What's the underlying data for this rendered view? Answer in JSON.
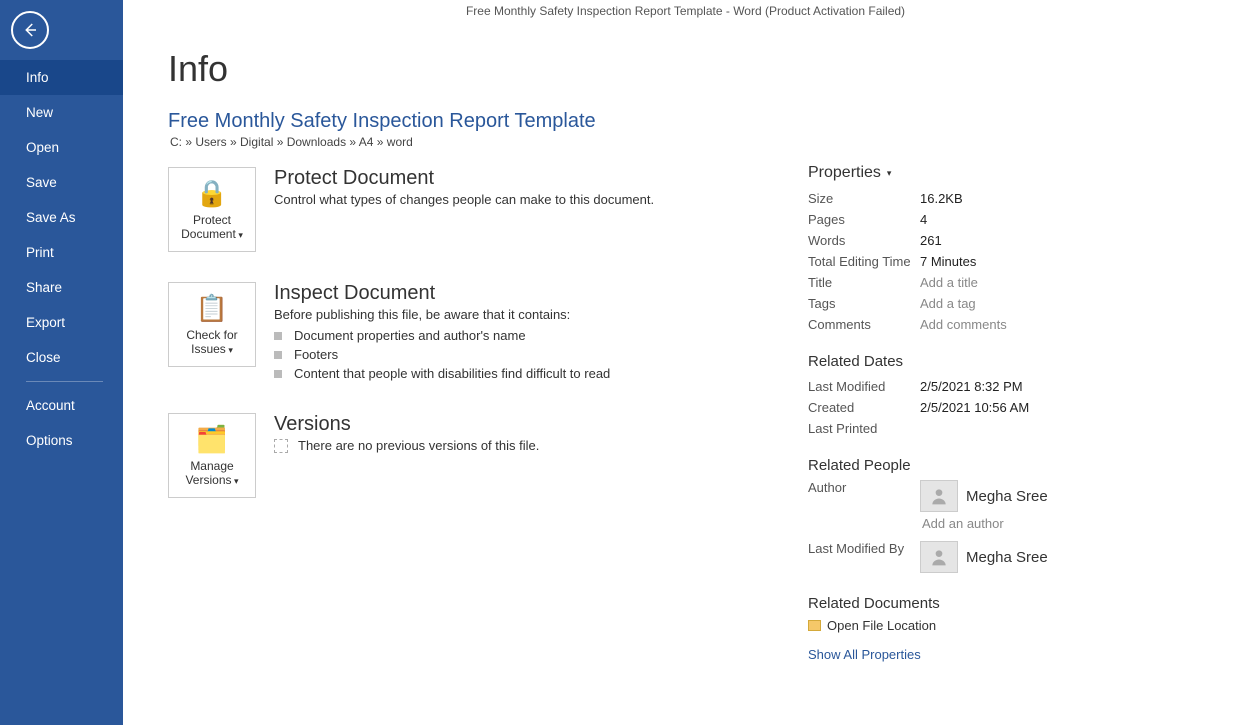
{
  "titlebar": "Free Monthly Safety Inspection Report Template - Word (Product Activation Failed)",
  "sidebar": {
    "items": [
      "Info",
      "New",
      "Open",
      "Save",
      "Save As",
      "Print",
      "Share",
      "Export",
      "Close"
    ],
    "bottom": [
      "Account",
      "Options"
    ],
    "active": "Info"
  },
  "page": {
    "title": "Info",
    "docTitle": "Free Monthly Safety Inspection Report Template",
    "docPath": "C: » Users » Digital » Downloads » A4 » word"
  },
  "protect": {
    "tileLine1": "Protect",
    "tileLine2": "Document",
    "heading": "Protect Document",
    "desc": "Control what types of changes people can make to this document."
  },
  "inspect": {
    "tileLine1": "Check for",
    "tileLine2": "Issues",
    "heading": "Inspect Document",
    "desc": "Before publishing this file, be aware that it contains:",
    "items": [
      "Document properties and author's name",
      "Footers",
      "Content that people with disabilities find difficult to read"
    ]
  },
  "versions": {
    "tileLine1": "Manage",
    "tileLine2": "Versions",
    "heading": "Versions",
    "empty": "There are no previous versions of this file."
  },
  "properties": {
    "header": "Properties",
    "items": {
      "Size": "16.2KB",
      "Pages": "4",
      "Words": "261",
      "TotalEditingTime": "7 Minutes",
      "Title": "Add a title",
      "Tags": "Add a tag",
      "Comments": "Add comments"
    },
    "labels": {
      "Size": "Size",
      "Pages": "Pages",
      "Words": "Words",
      "TotalEditingTime": "Total Editing Time",
      "Title": "Title",
      "Tags": "Tags",
      "Comments": "Comments"
    }
  },
  "dates": {
    "header": "Related Dates",
    "LastModified": {
      "label": "Last Modified",
      "value": "2/5/2021 8:32 PM"
    },
    "Created": {
      "label": "Created",
      "value": "2/5/2021 10:56 AM"
    },
    "LastPrinted": {
      "label": "Last Printed",
      "value": ""
    }
  },
  "people": {
    "header": "Related People",
    "authorLabel": "Author",
    "authorName": "Megha Sree",
    "addAuthor": "Add an author",
    "lastModByLabel": "Last Modified By",
    "lastModByName": "Megha Sree"
  },
  "docs": {
    "header": "Related Documents",
    "openLocation": "Open File Location",
    "showAll": "Show All Properties"
  }
}
